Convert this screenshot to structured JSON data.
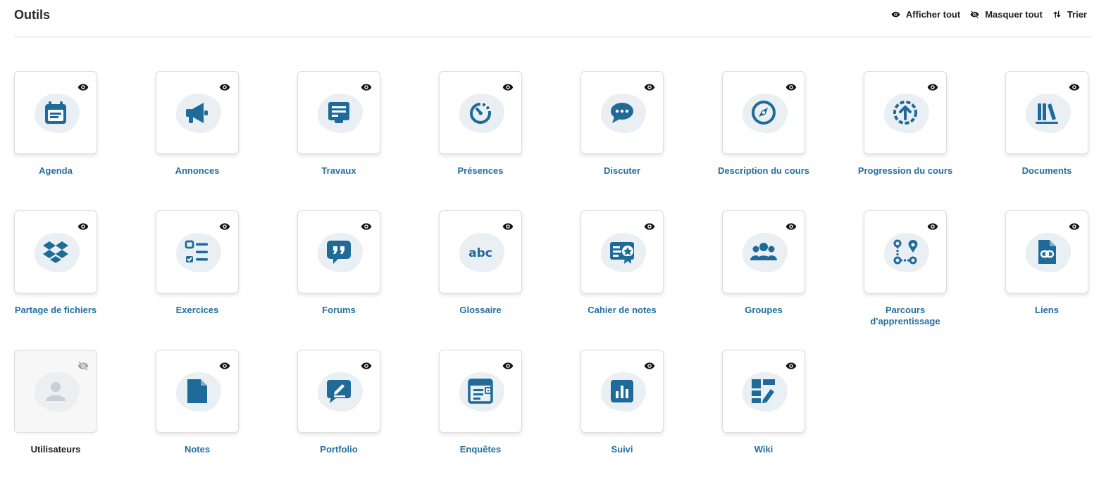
{
  "page": {
    "title": "Outils"
  },
  "actions": {
    "show_all": "Afficher tout",
    "hide_all": "Masquer tout",
    "sort": "Trier"
  },
  "colors": {
    "icon": "#1e6a98",
    "label": "#236f9f",
    "hidden_icon": "#c7ced6",
    "blob": "#eaeff4"
  },
  "tools": [
    {
      "label": "Agenda",
      "icon": "calendar-icon",
      "visible": true
    },
    {
      "label": "Annonces",
      "icon": "megaphone-icon",
      "visible": true
    },
    {
      "label": "Travaux",
      "icon": "assignment-icon",
      "visible": true
    },
    {
      "label": "Présences",
      "icon": "attendance-icon",
      "visible": true
    },
    {
      "label": "Discuter",
      "icon": "chat-icon",
      "visible": true
    },
    {
      "label": "Description du cours",
      "icon": "compass-icon",
      "visible": true
    },
    {
      "label": "Progression du cours",
      "icon": "progress-icon",
      "visible": true
    },
    {
      "label": "Documents",
      "icon": "books-icon",
      "visible": true
    },
    {
      "label": "Partage de fichiers",
      "icon": "dropbox-icon",
      "visible": true
    },
    {
      "label": "Exercices",
      "icon": "checklist-icon",
      "visible": true
    },
    {
      "label": "Forums",
      "icon": "forum-icon",
      "visible": true
    },
    {
      "label": "Glossaire",
      "icon": "glossary-icon",
      "visible": true
    },
    {
      "label": "Cahier de notes",
      "icon": "certificate-icon",
      "visible": true
    },
    {
      "label": "Groupes",
      "icon": "groups-icon",
      "visible": true
    },
    {
      "label": "Parcours d'apprentissage",
      "icon": "route-icon",
      "visible": true
    },
    {
      "label": "Liens",
      "icon": "link-file-icon",
      "visible": true
    },
    {
      "label": "Utilisateurs",
      "icon": "user-icon",
      "visible": false
    },
    {
      "label": "Notes",
      "icon": "note-icon",
      "visible": true
    },
    {
      "label": "Portfolio",
      "icon": "portfolio-icon",
      "visible": true
    },
    {
      "label": "Enquêtes",
      "icon": "survey-icon",
      "visible": true
    },
    {
      "label": "Suivi",
      "icon": "chart-icon",
      "visible": true
    },
    {
      "label": "Wiki",
      "icon": "wiki-icon",
      "visible": true
    }
  ]
}
